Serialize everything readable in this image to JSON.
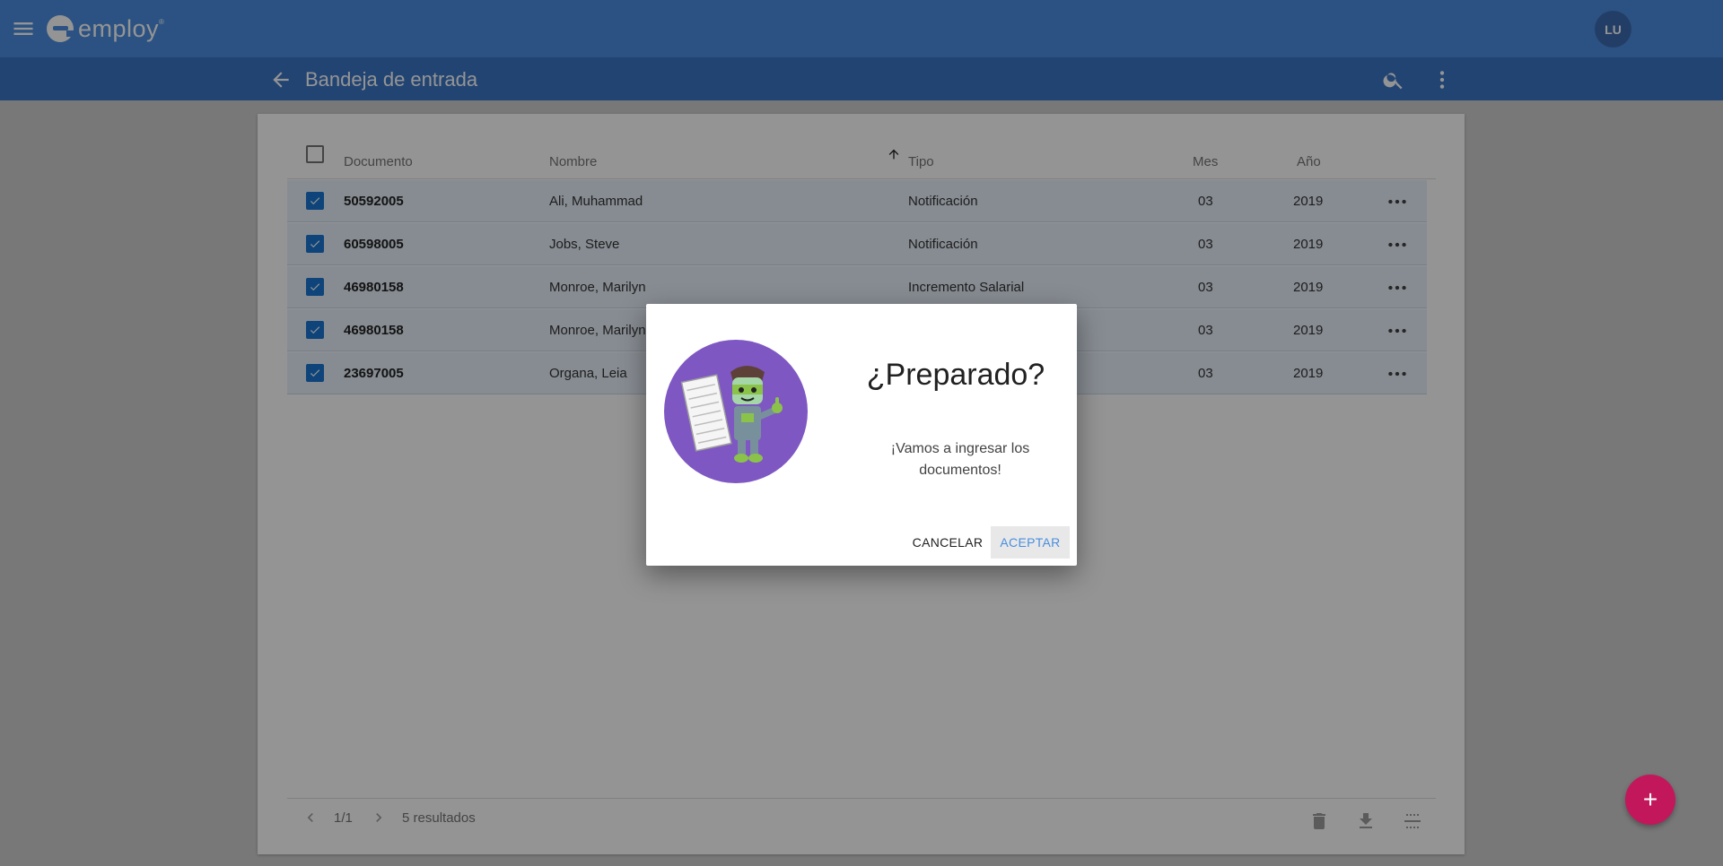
{
  "app": {
    "logo_text": "employ",
    "logo_tm": "®",
    "avatar_initials": "LU"
  },
  "header": {
    "title": "Bandeja de entrada"
  },
  "table": {
    "columns": {
      "documento": "Documento",
      "nombre": "Nombre",
      "tipo": "Tipo",
      "mes": "Mes",
      "anio": "Año"
    },
    "rows": [
      {
        "documento": "50592005",
        "nombre": "Ali, Muhammad",
        "tipo": "Notificación",
        "mes": "03",
        "anio": "2019",
        "checked": true
      },
      {
        "documento": "60598005",
        "nombre": "Jobs, Steve",
        "tipo": "Notificación",
        "mes": "03",
        "anio": "2019",
        "checked": true
      },
      {
        "documento": "46980158",
        "nombre": "Monroe, Marilyn",
        "tipo": "Incremento Salarial",
        "mes": "03",
        "anio": "2019",
        "checked": true
      },
      {
        "documento": "46980158",
        "nombre": "Monroe, Marilyn",
        "tipo": "",
        "mes": "03",
        "anio": "2019",
        "checked": true
      },
      {
        "documento": "23697005",
        "nombre": "Organa, Leia",
        "tipo": "",
        "mes": "03",
        "anio": "2019",
        "checked": true
      }
    ]
  },
  "footer": {
    "page": "1/1",
    "results": "5 resultados"
  },
  "dialog": {
    "title": "¿Preparado?",
    "message": "¡Vamos a ingresar los documentos!",
    "cancel_label": "CANCELAR",
    "accept_label": "ACEPTAR"
  },
  "fab": {
    "label": "+"
  },
  "colors": {
    "topbar": "#4a8ee0",
    "subbar": "#3b76c7",
    "fab": "#c2185b",
    "illustration_bg": "#7e57c2",
    "accent": "#4a8ee0"
  }
}
